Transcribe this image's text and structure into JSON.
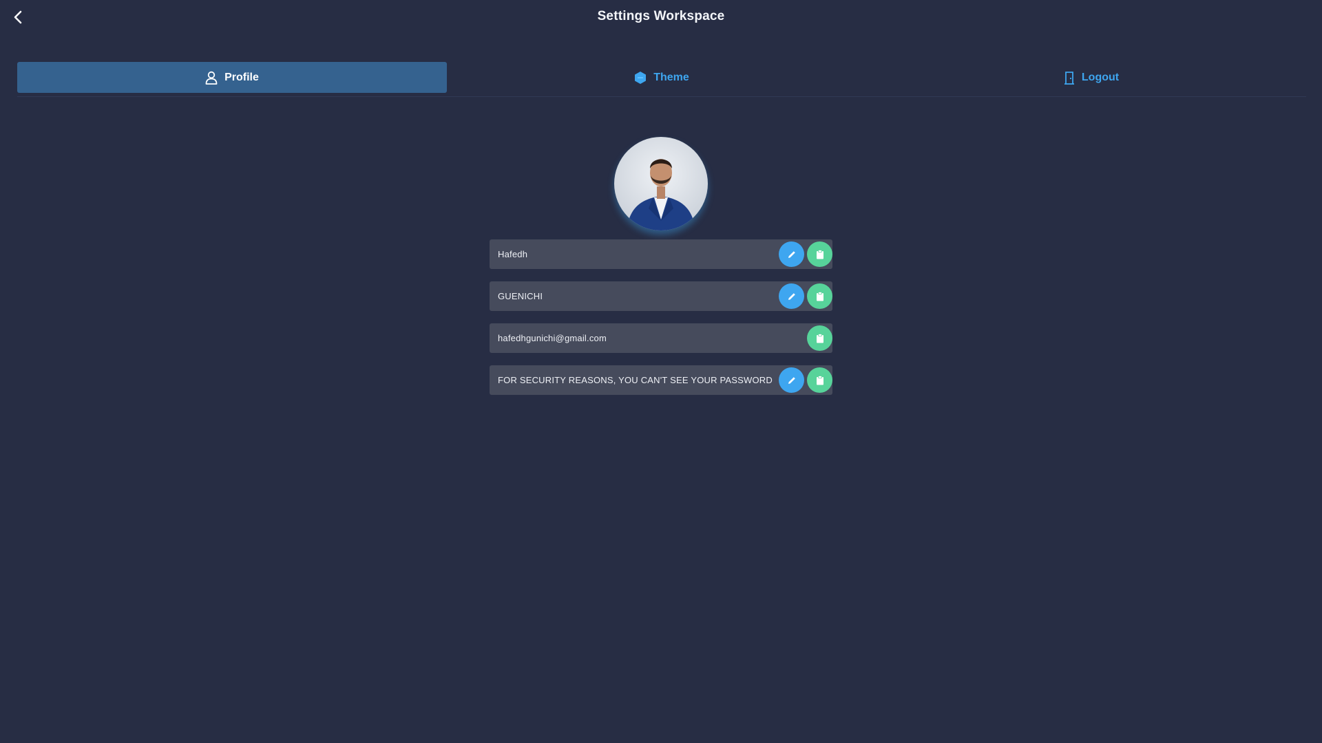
{
  "header": {
    "title": "Settings Workspace",
    "back_icon": "chevron-left-icon"
  },
  "tabs": [
    {
      "label": "Profile",
      "icon": "user-icon",
      "active": true
    },
    {
      "label": "Theme",
      "icon": "hexagon-icon",
      "active": false
    },
    {
      "label": "Logout",
      "icon": "door-icon",
      "active": false
    }
  ],
  "profile": {
    "avatar_icon": "avatar-photo",
    "fields": [
      {
        "value": "Hafedh",
        "editable": true
      },
      {
        "value": "GUENICHI",
        "editable": true
      },
      {
        "value": "hafedhgunichi@gmail.com",
        "editable": false
      },
      {
        "value": "FOR SECURITY REASONS, YOU CAN'T SEE YOUR PASSWORD",
        "editable": true
      }
    ]
  },
  "colors": {
    "background": "#272d44",
    "active_tab": "#35628f",
    "accent_blue": "#3ea6f0",
    "accent_green": "#57d39a",
    "field_bg": "#464b5c"
  }
}
